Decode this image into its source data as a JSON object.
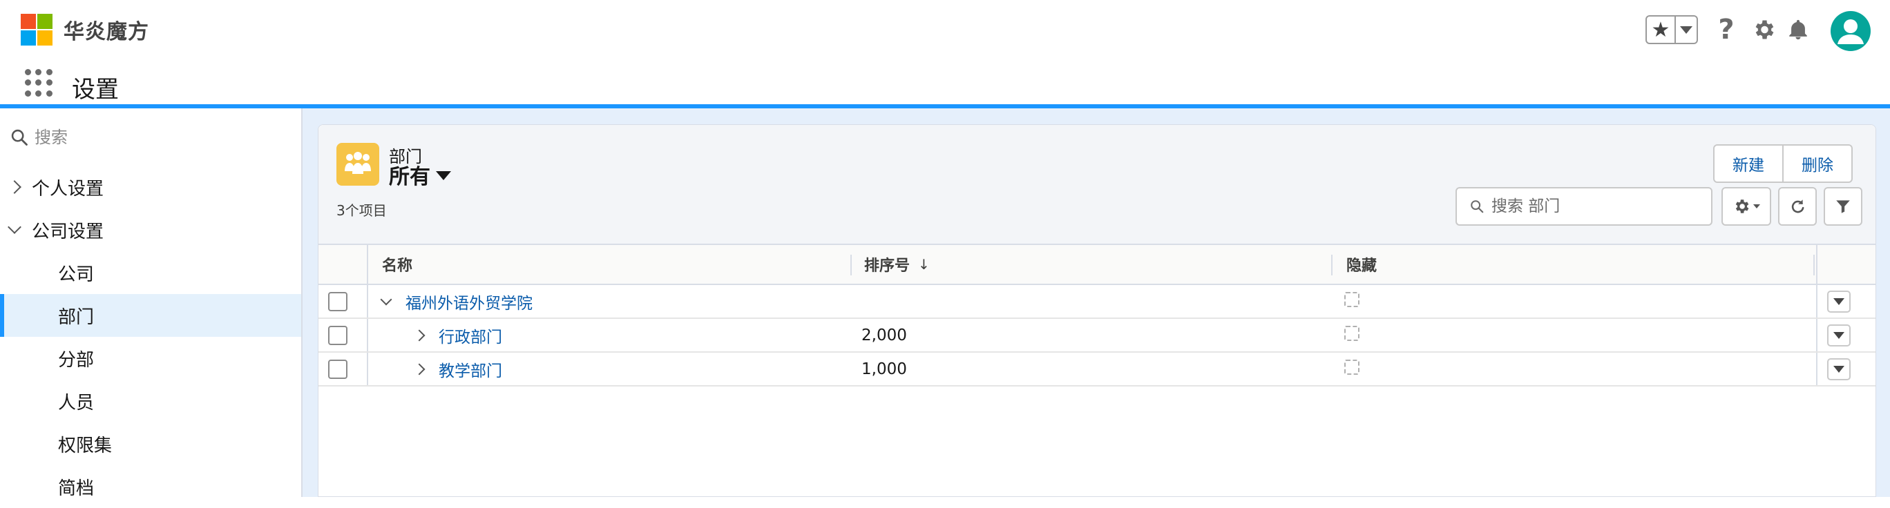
{
  "app": {
    "brand": "华炎魔方",
    "title": "设置"
  },
  "header": {
    "icons": [
      "star-icon",
      "chevron-down-icon",
      "help-icon",
      "gear-icon",
      "bell-icon",
      "avatar"
    ],
    "accent": "#1b96ff"
  },
  "sidebar": {
    "search_placeholder": "搜索",
    "sections": [
      {
        "label": "个人设置",
        "expanded": false
      },
      {
        "label": "公司设置",
        "expanded": true
      }
    ],
    "items": [
      {
        "label": "公司",
        "active": false
      },
      {
        "label": "部门",
        "active": true
      },
      {
        "label": "分部",
        "active": false
      },
      {
        "label": "人员",
        "active": false
      },
      {
        "label": "权限集",
        "active": false
      },
      {
        "label": "简档",
        "active": false
      }
    ]
  },
  "list": {
    "object_label": "部门",
    "view_name": "所有",
    "item_count": "3个项目",
    "new_button": "新建",
    "delete_button": "删除",
    "search_placeholder": "搜索 部门",
    "columns": {
      "name": "名称",
      "sort_no": "排序号",
      "hidden": "隐藏"
    },
    "sort_arrow": "↓",
    "rows": [
      {
        "name": "福州外语外贸学院",
        "sort_no": "",
        "expanded": true,
        "level": 0
      },
      {
        "name": "行政部门",
        "sort_no": "2,000",
        "expanded": false,
        "level": 1
      },
      {
        "name": "教学部门",
        "sort_no": "1,000",
        "expanded": false,
        "level": 1
      }
    ]
  },
  "colors": {
    "link": "#0b5cab",
    "icon_bg": "#f6c447",
    "avatar_bg": "#06a59a",
    "main_bg": "#e5effb"
  }
}
